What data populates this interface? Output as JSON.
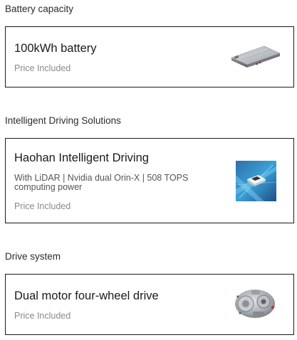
{
  "sections": [
    {
      "title": "Battery capacity",
      "option": {
        "name": "100kWh battery",
        "price": "Price Included",
        "image_icon": "battery-pack-icon"
      }
    },
    {
      "title": "Intelligent Driving Solutions",
      "option": {
        "name": "Haohan Intelligent Driving",
        "description": "With LiDAR | Nvidia dual Orin-X | 508 TOPS computing power",
        "price": "Price Included",
        "image_icon": "intelligent-driving-icon"
      }
    },
    {
      "title": "Drive system",
      "option": {
        "name": "Dual motor four-wheel drive",
        "price": "Price Included",
        "image_icon": "electric-motor-icon"
      }
    }
  ]
}
